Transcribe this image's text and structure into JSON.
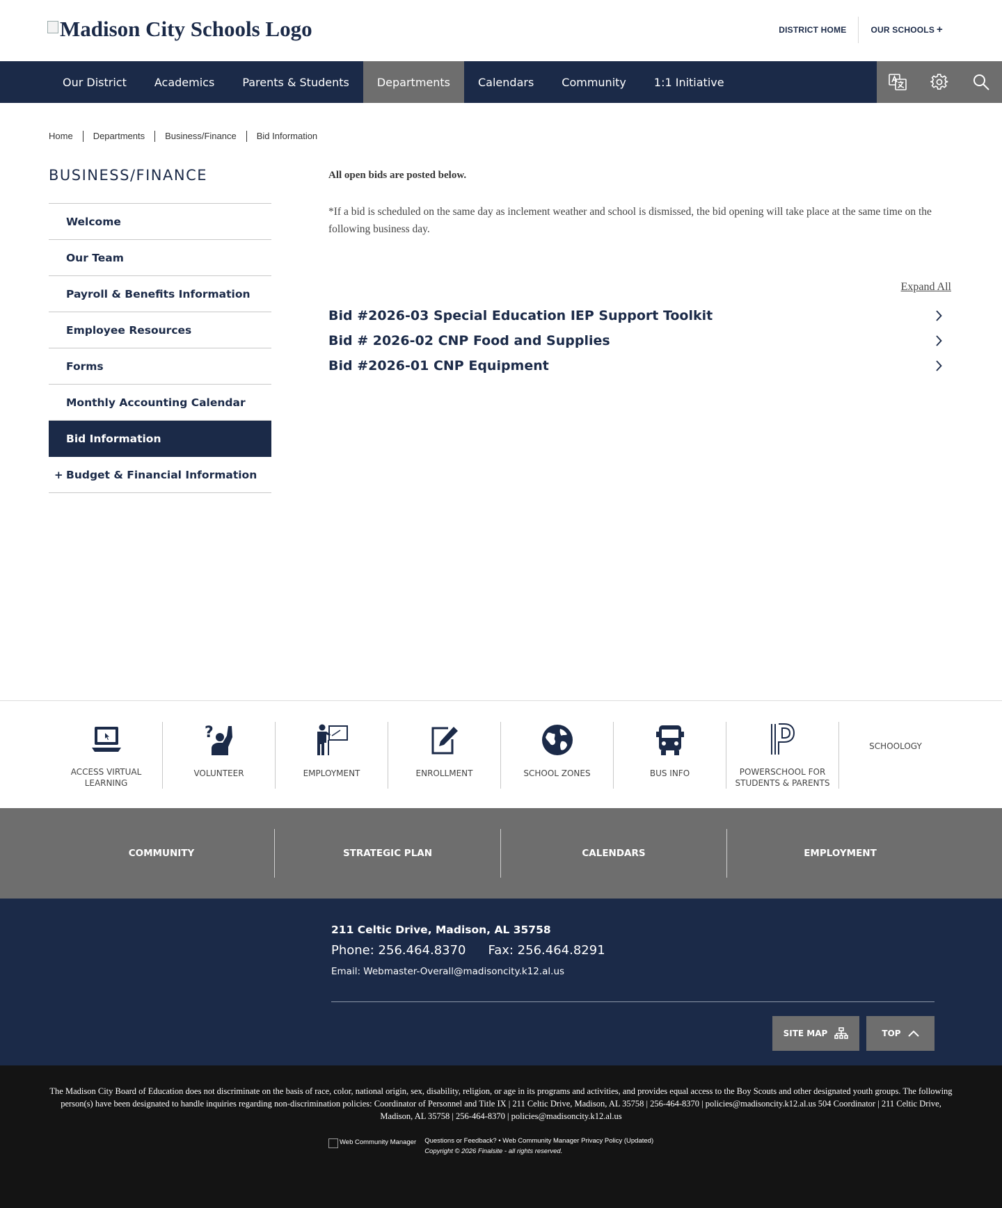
{
  "header": {
    "logo_alt": "Madison City Schools Logo",
    "util_links": [
      "DISTRICT HOME",
      "OUR SCHOOLS"
    ],
    "util_plus": "+"
  },
  "nav": {
    "items": [
      "Our District",
      "Academics",
      "Parents & Students",
      "Departments",
      "Calendars",
      "Community",
      "1:1 Initiative"
    ],
    "active_index": 3,
    "tools": [
      "translate-icon",
      "gear-icon",
      "search-icon"
    ]
  },
  "breadcrumb": [
    "Home",
    "Departments",
    "Business/Finance",
    "Bid Information"
  ],
  "sidebar": {
    "title": "BUSINESS/FINANCE",
    "items": [
      {
        "label": "Welcome"
      },
      {
        "label": "Our Team"
      },
      {
        "label": "Payroll & Benefits Information"
      },
      {
        "label": "Employee Resources"
      },
      {
        "label": "Forms"
      },
      {
        "label": "Monthly Accounting Calendar"
      },
      {
        "label": "Bid Information"
      },
      {
        "label": "Budget & Financial Information",
        "expand_mark": "+"
      }
    ],
    "active_index": 6
  },
  "content": {
    "intro": "All open bids are posted below.",
    "note": "*If a bid is scheduled on the same day as inclement weather and school is dismissed, the bid opening will take place at the same time on the following business day.",
    "expand_all": "Expand All",
    "bids": [
      "Bid #2026-03 Special Education IEP Support Toolkit",
      "Bid # 2026-02 CNP Food and Supplies",
      "Bid #2026-01 CNP Equipment"
    ]
  },
  "quick_links": [
    {
      "label": "ACCESS VIRTUAL LEARNING",
      "icon": "laptop-icon"
    },
    {
      "label": "VOLUNTEER",
      "icon": "volunteer-icon"
    },
    {
      "label": "EMPLOYMENT",
      "icon": "teacher-board-icon"
    },
    {
      "label": "ENROLLMENT",
      "icon": "pencil-form-icon"
    },
    {
      "label": "SCHOOL ZONES",
      "icon": "globe-icon"
    },
    {
      "label": "BUS INFO",
      "icon": "bus-icon"
    },
    {
      "label": "POWERSCHOOL FOR STUDENTS & PARENTS",
      "icon": "powerschool-icon"
    },
    {
      "label": "SCHOOLOGY",
      "icon": ""
    }
  ],
  "gray_links": [
    "COMMUNITY",
    "STRATEGIC PLAN",
    "CALENDARS",
    "EMPLOYMENT"
  ],
  "footer": {
    "address": "211 Celtic Drive, Madison, AL 35758",
    "phone": "Phone: 256.464.8370",
    "fax": "Fax: 256.464.8291",
    "email": "Email: Webmaster-Overall@madisoncity.k12.al.us",
    "site_map": "SITE MAP",
    "top": "TOP"
  },
  "legal": {
    "text": "The Madison City Board of Education does not discriminate on the basis of race, color, national origin, sex, disability, religion, or age in its programs and activities, and provides equal access to the Boy Scouts and other designated youth groups. The following person(s) have been designated to handle inquiries regarding non-discrimination policies: Coordinator of Personnel and Title IX | 211 Celtic Drive, Madison, AL 35758 | 256-464-8370 | policies@madisoncity.k12.al.us 504 Coordinator | 211 Celtic Drive, Madison, AL 35758 | 256-464-8370 | policies@madisoncity.k12.al.us",
    "wcm_alt": "Web Community Manager",
    "links_line": "Questions or Feedback? • Web Community Manager Privacy Policy (Updated)",
    "copyright": "Copyright © 2026 Finalsite - all rights reserved."
  },
  "colors": {
    "navy": "#1b2a48",
    "gray": "#6e6e6e",
    "black": "#141414"
  }
}
